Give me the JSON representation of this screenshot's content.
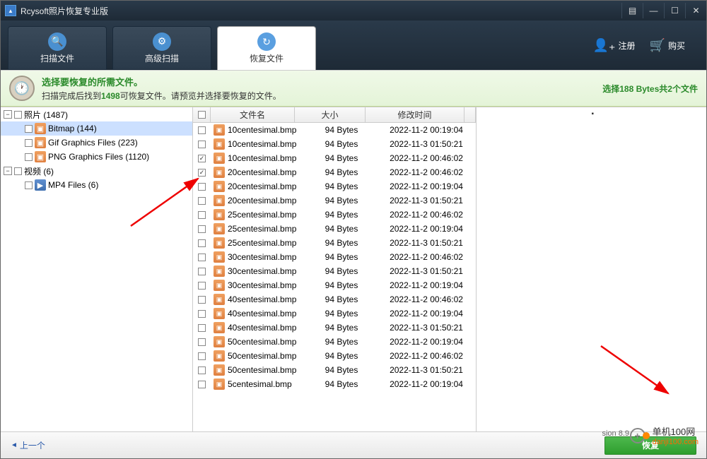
{
  "title": "Rcysoft照片恢复专业版",
  "toolbar": {
    "tabs": [
      {
        "label": "扫描文件",
        "icon": "🔍"
      },
      {
        "label": "高级扫描",
        "icon": "⚙"
      },
      {
        "label": "恢复文件",
        "icon": "↻"
      }
    ],
    "register": "注册",
    "buy": "购买"
  },
  "infobar": {
    "title": "选择要恢复的所需文件。",
    "sub_before": "扫描完成后找到",
    "sub_count": "1498",
    "sub_after": "可恢复文件。请预览并选择要恢复的文件。",
    "right_before": "选择",
    "right_size": "188 Bytes",
    "right_mid": "共",
    "right_count": "2",
    "right_after": "个文件"
  },
  "tree": {
    "photos": {
      "label": "照片 (1487)"
    },
    "bitmap": {
      "label": "Bitmap (144)"
    },
    "gif": {
      "label": "Gif Graphics Files (223)"
    },
    "png": {
      "label": "PNG Graphics Files (1120)"
    },
    "videos": {
      "label": "视频 (6)"
    },
    "mp4": {
      "label": "MP4 Files (6)"
    }
  },
  "grid": {
    "col_name": "文件名",
    "col_size": "大小",
    "col_date": "修改时间",
    "rows": [
      {
        "name": "10centesimal.bmp",
        "size": "94 Bytes",
        "date": "2022-11-2 00:19:04",
        "checked": false
      },
      {
        "name": "10centesimal.bmp",
        "size": "94 Bytes",
        "date": "2022-11-3 01:50:21",
        "checked": false
      },
      {
        "name": "10centesimal.bmp",
        "size": "94 Bytes",
        "date": "2022-11-2 00:46:02",
        "checked": true
      },
      {
        "name": "20centesimal.bmp",
        "size": "94 Bytes",
        "date": "2022-11-2 00:46:02",
        "checked": true
      },
      {
        "name": "20centesimal.bmp",
        "size": "94 Bytes",
        "date": "2022-11-2 00:19:04",
        "checked": false
      },
      {
        "name": "20centesimal.bmp",
        "size": "94 Bytes",
        "date": "2022-11-3 01:50:21",
        "checked": false
      },
      {
        "name": "25centesimal.bmp",
        "size": "94 Bytes",
        "date": "2022-11-2 00:46:02",
        "checked": false
      },
      {
        "name": "25centesimal.bmp",
        "size": "94 Bytes",
        "date": "2022-11-2 00:19:04",
        "checked": false
      },
      {
        "name": "25centesimal.bmp",
        "size": "94 Bytes",
        "date": "2022-11-3 01:50:21",
        "checked": false
      },
      {
        "name": "30centesimal.bmp",
        "size": "94 Bytes",
        "date": "2022-11-2 00:46:02",
        "checked": false
      },
      {
        "name": "30centesimal.bmp",
        "size": "94 Bytes",
        "date": "2022-11-3 01:50:21",
        "checked": false
      },
      {
        "name": "30centesimal.bmp",
        "size": "94 Bytes",
        "date": "2022-11-2 00:19:04",
        "checked": false
      },
      {
        "name": "40sentesimal.bmp",
        "size": "94 Bytes",
        "date": "2022-11-2 00:46:02",
        "checked": false
      },
      {
        "name": "40sentesimal.bmp",
        "size": "94 Bytes",
        "date": "2022-11-2 00:19:04",
        "checked": false
      },
      {
        "name": "40sentesimal.bmp",
        "size": "94 Bytes",
        "date": "2022-11-3 01:50:21",
        "checked": false
      },
      {
        "name": "50centesimal.bmp",
        "size": "94 Bytes",
        "date": "2022-11-2 00:19:04",
        "checked": false
      },
      {
        "name": "50centesimal.bmp",
        "size": "94 Bytes",
        "date": "2022-11-2 00:46:02",
        "checked": false
      },
      {
        "name": "50centesimal.bmp",
        "size": "94 Bytes",
        "date": "2022-11-3 01:50:21",
        "checked": false
      },
      {
        "name": "5centesimal.bmp",
        "size": "94 Bytes",
        "date": "2022-11-2 00:19:04",
        "checked": false
      }
    ]
  },
  "bottom": {
    "back": "上一个",
    "recover": "恢复"
  },
  "version": "sion 8.9",
  "watermark": {
    "text1": "单机100网",
    "text2": "danji100.com"
  }
}
